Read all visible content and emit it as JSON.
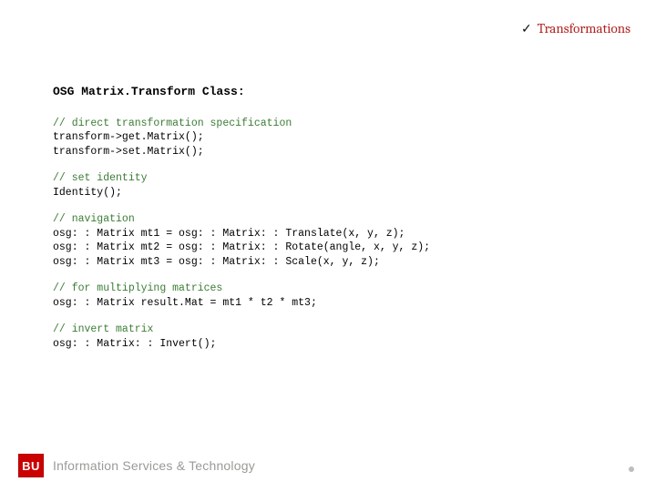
{
  "header": {
    "checkmark": "✓",
    "title": "Transformations"
  },
  "content": {
    "heading": "OSG Matrix.Transform Class:",
    "blocks": [
      {
        "comment": "// direct transformation specification",
        "code": "transform->get.Matrix();\ntransform->set.Matrix();"
      },
      {
        "comment": "// set identity",
        "code": "Identity();"
      },
      {
        "comment": "// navigation",
        "code": "osg: : Matrix mt1 = osg: : Matrix: : Translate(x, y, z);\nosg: : Matrix mt2 = osg: : Matrix: : Rotate(angle, x, y, z);\nosg: : Matrix mt3 = osg: : Matrix: : Scale(x, y, z);"
      },
      {
        "comment": "// for multiplying matrices",
        "code": "osg: : Matrix result.Mat = mt1 * t2 * mt3;"
      },
      {
        "comment": "// invert matrix",
        "code": "osg: : Matrix: : Invert();"
      }
    ]
  },
  "footer": {
    "badge": "BU",
    "org": "Information Services & Technology"
  }
}
